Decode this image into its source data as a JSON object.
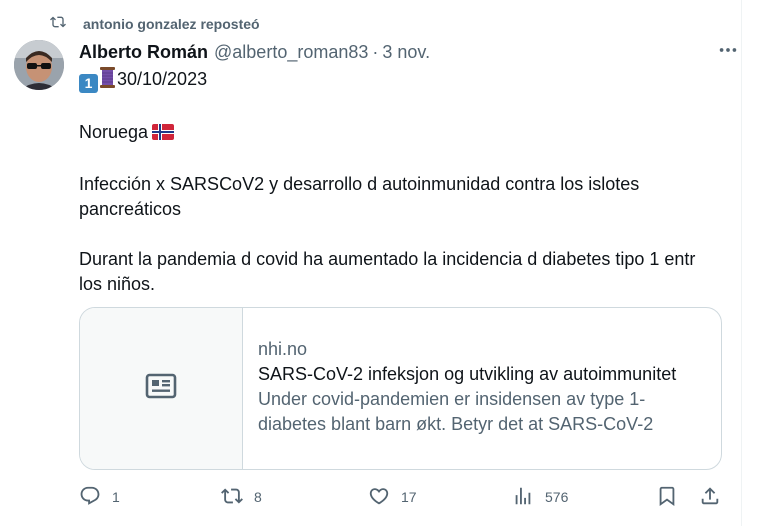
{
  "repost": {
    "text": "antonio gonzalez reposteó",
    "icon": "repost-icon"
  },
  "post": {
    "author_name": "Alberto Román",
    "author_handle": "@alberto_roman83",
    "separator": "·",
    "time": "3 nov.",
    "emoji_number": "1",
    "date_line": "30/10/2023",
    "country": "Noruega",
    "paragraph_1": "Infección x SARSCoV2 y desarrollo d autoinmunidad contra los islotes pancreáticos",
    "paragraph_2": "Durant la pandemia d covid ha aumentado la incidencia d diabetes tipo 1 entr los niños."
  },
  "card": {
    "domain": "nhi.no",
    "title": "SARS-CoV-2 infeksjon og utvikling av autoimmunitet",
    "description": "Under covid-pandemien er insidensen av type 1-diabetes blant barn økt. Betyr det at SARS-CoV-2"
  },
  "actions": {
    "replies": "1",
    "reposts": "8",
    "likes": "17",
    "views": "576"
  },
  "colors": {
    "text": "#0f1419",
    "muted": "#536471",
    "border": "#cfd9de"
  }
}
